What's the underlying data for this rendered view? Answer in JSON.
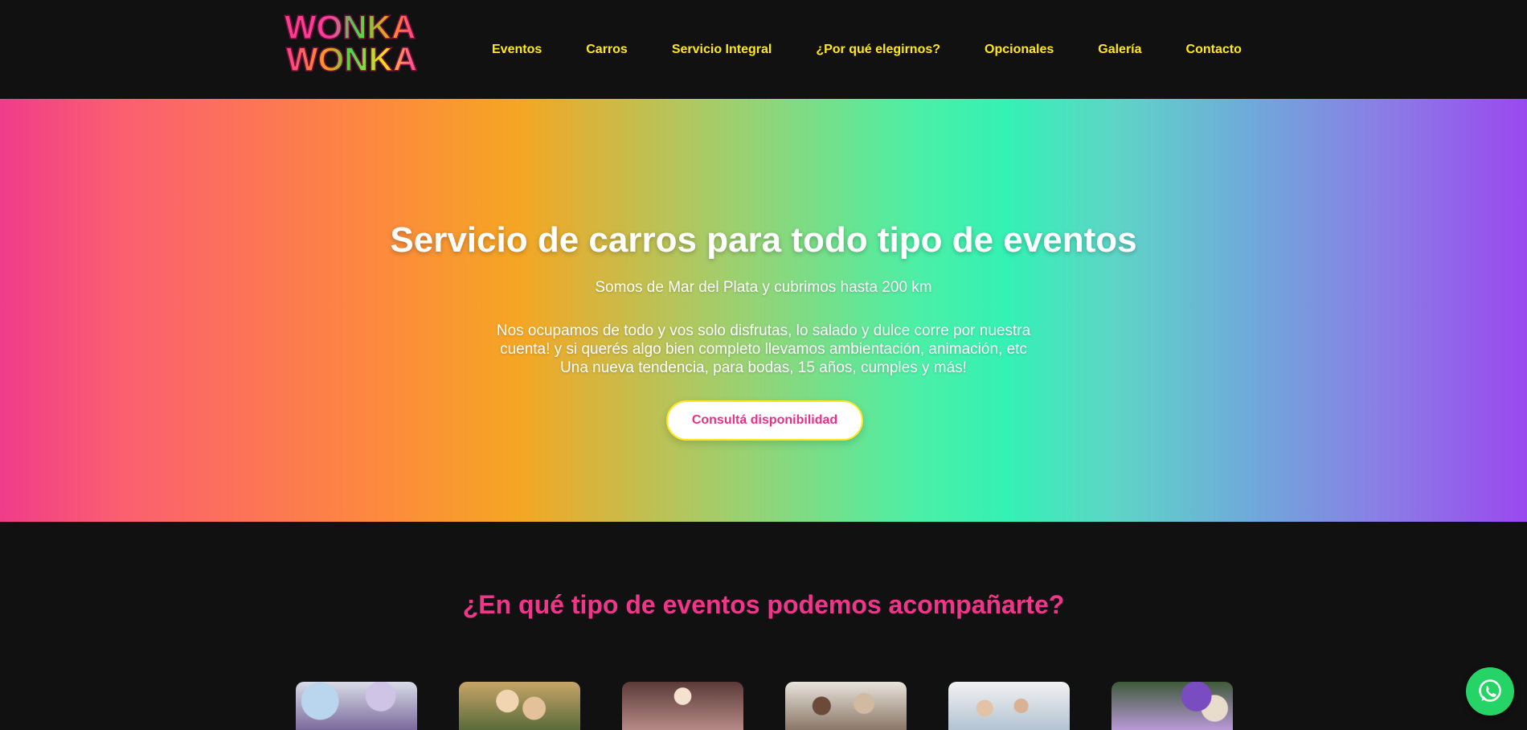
{
  "header": {
    "logo_alt": "WONKA WONKA",
    "logo_line1": "WONKA",
    "logo_line2": "WONKA",
    "nav": [
      {
        "label": "Eventos"
      },
      {
        "label": "Carros"
      },
      {
        "label": "Servicio Integral"
      },
      {
        "label": "¿Por qué elegirnos?"
      },
      {
        "label": "Opcionales"
      },
      {
        "label": "Galería"
      },
      {
        "label": "Contacto"
      }
    ]
  },
  "hero": {
    "title": "Servicio de carros para todo tipo de eventos",
    "subtitle": "Somos de Mar del Plata y cubrimos hasta 200 km",
    "description_lines": [
      "Nos ocupamos de todo y vos solo disfrutas, lo salado y dulce corre por nuestra",
      "cuenta! y si querés algo bien completo llevamos ambientación, animación, etc",
      "Una nueva tendencia, para bodas, 15 años, cumples y más!"
    ],
    "cta_label": "Consultá disponibilidad"
  },
  "events": {
    "heading": "¿En qué tipo de eventos podemos acompañarte?",
    "cards": [
      {
        "image": "event-photo-balloons"
      },
      {
        "image": "event-photo-wedding"
      },
      {
        "image": "event-photo-quinceanera"
      },
      {
        "image": "event-photo-celebration"
      },
      {
        "image": "event-photo-group"
      },
      {
        "image": "event-photo-decoration"
      }
    ]
  },
  "floating": {
    "whatsapp_icon": "whatsapp-icon"
  },
  "colors": {
    "header_bg": "#111111",
    "nav_text": "#ffe81a",
    "heading_pink": "#f0368a",
    "cta_text": "#ec2f86",
    "whatsapp": "#25d366"
  }
}
